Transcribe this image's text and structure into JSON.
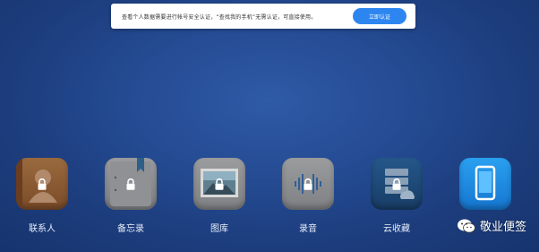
{
  "banner": {
    "message": "查看个人数据需要进行帐号安全认证，“查找我的手机”无需认证，可直接使用。",
    "button_label": "立即认证"
  },
  "apps": [
    {
      "label": "联系人",
      "icon": "contacts-icon",
      "locked": true,
      "color": "#8a5a32"
    },
    {
      "label": "备忘录",
      "icon": "notes-icon",
      "locked": true,
      "color": "#8d8f91"
    },
    {
      "label": "图库",
      "icon": "gallery-icon",
      "locked": true,
      "color": "#8a8c90"
    },
    {
      "label": "录音",
      "icon": "recorder-icon",
      "locked": true,
      "color": "#8a8c90"
    },
    {
      "label": "云收藏",
      "icon": "cloud-favorites-icon",
      "locked": true,
      "color": "#1f4f7f"
    },
    {
      "label": "",
      "icon": "find-phone-icon",
      "locked": false,
      "color": "#1e8ee6"
    }
  ],
  "watermark": {
    "text": "敬业便签",
    "icon": "wechat-icon"
  }
}
